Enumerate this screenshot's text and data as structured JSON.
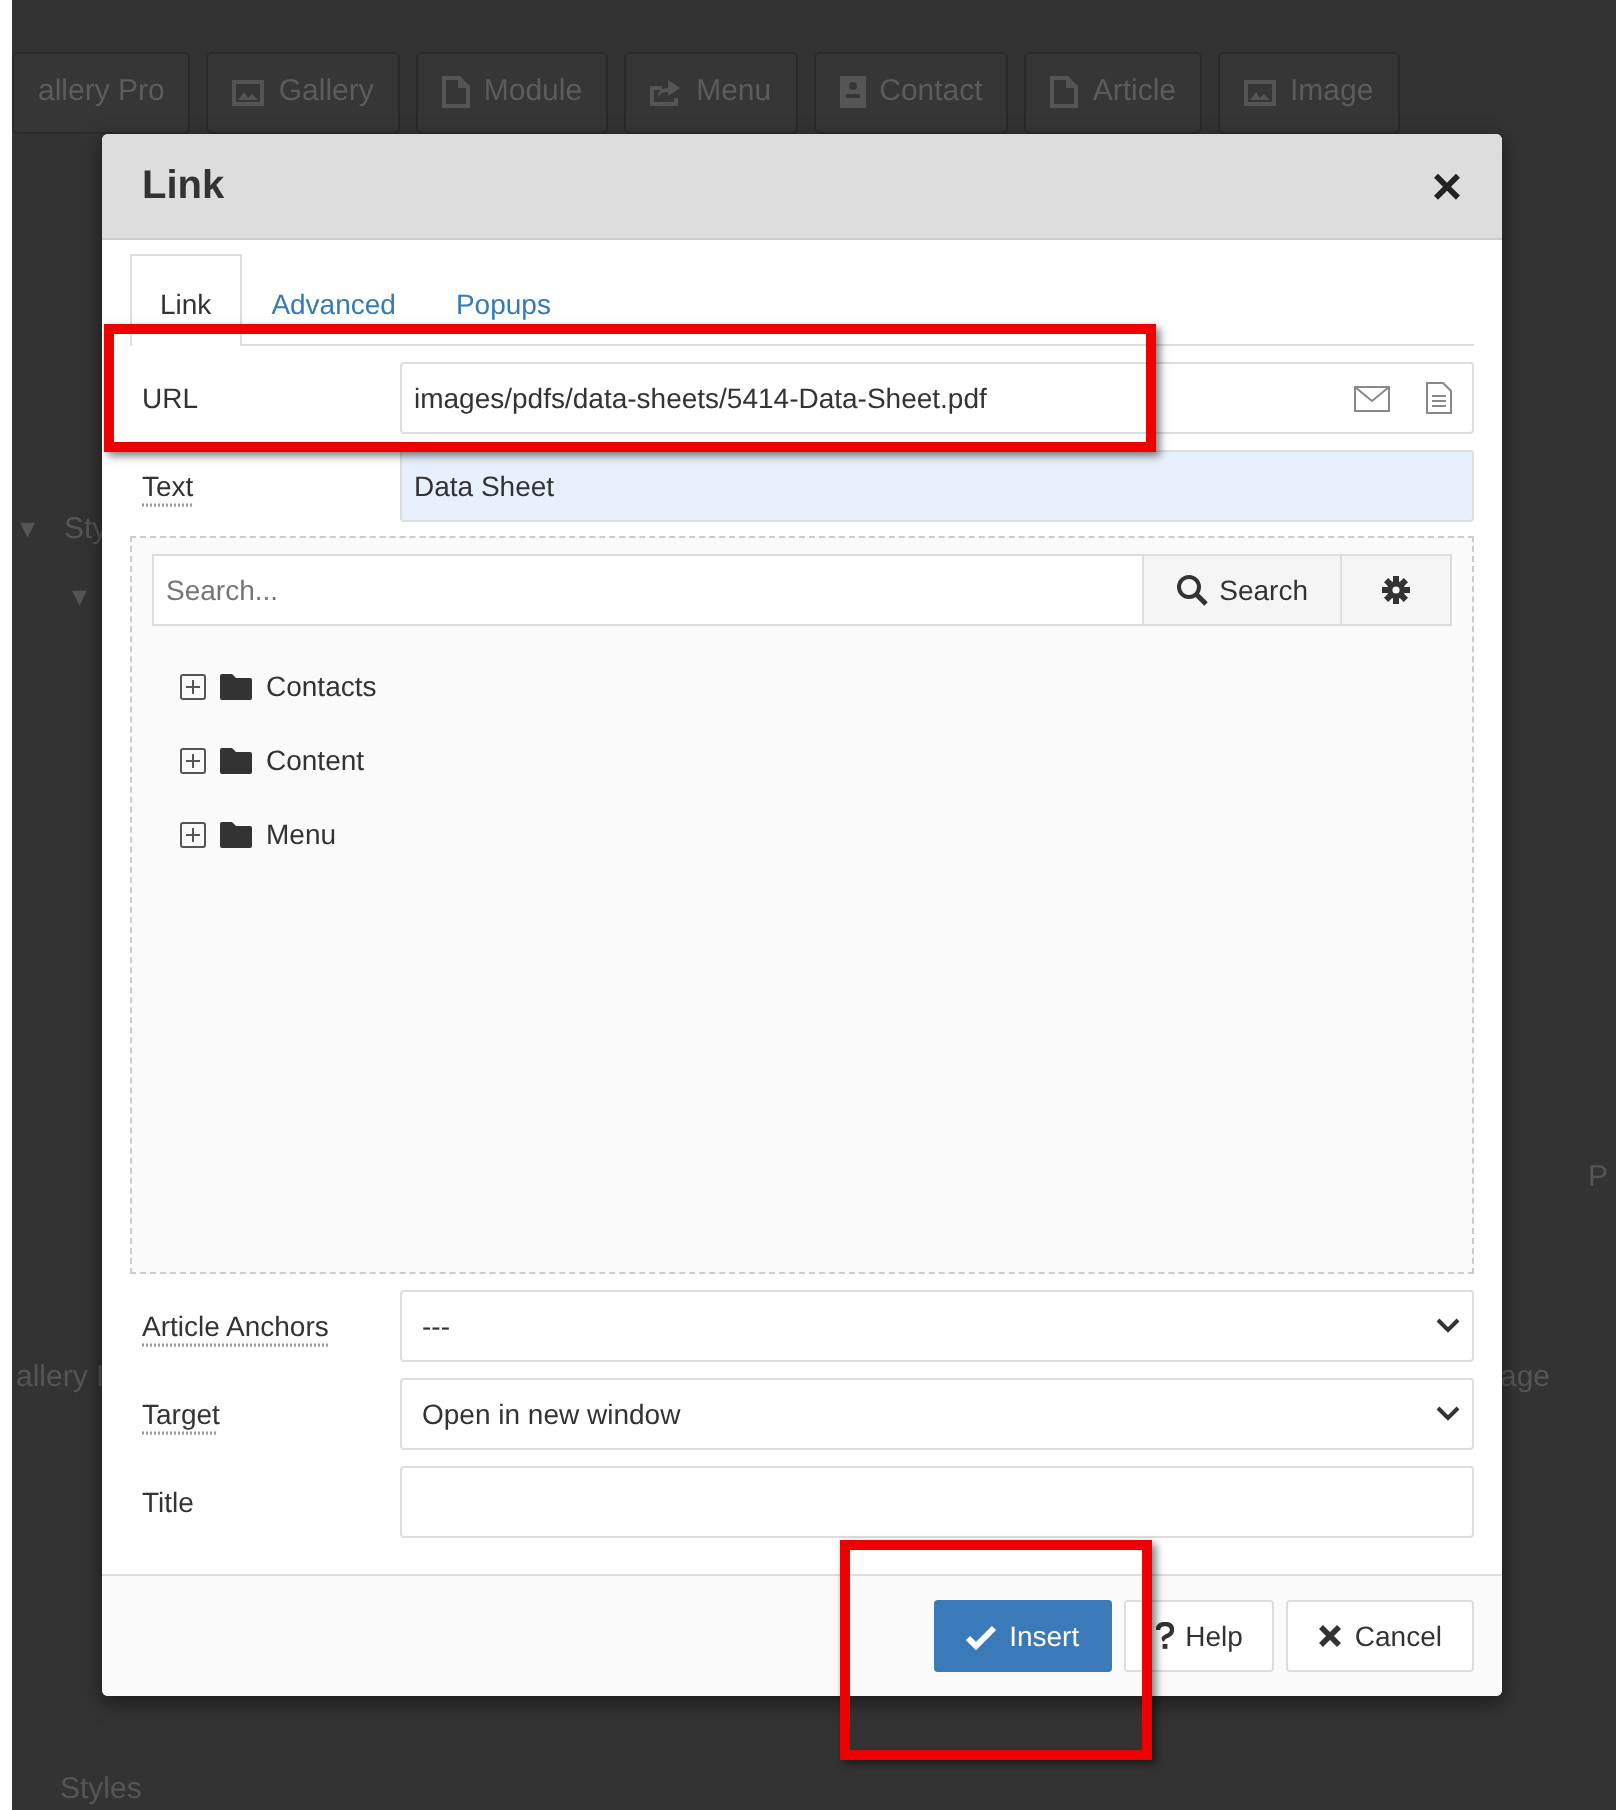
{
  "background_toolbar": [
    {
      "label": "allery Pro",
      "kind": "plain"
    },
    {
      "label": "Gallery",
      "kind": "image"
    },
    {
      "label": "Module",
      "kind": "page"
    },
    {
      "label": "Menu",
      "kind": "share"
    },
    {
      "label": "Contact",
      "kind": "card"
    },
    {
      "label": "Article",
      "kind": "page"
    },
    {
      "label": "Image",
      "kind": "image"
    }
  ],
  "background_texts": [
    {
      "kind": "side",
      "text": "▾"
    },
    {
      "kind": "side",
      "text": "Sty"
    },
    {
      "kind": "side",
      "text": "▾"
    },
    {
      "kind": "right",
      "text": "P"
    },
    {
      "kind": "btn-left",
      "text": "allery I"
    },
    {
      "kind": "btn-right",
      "text": "age"
    },
    {
      "kind": "bottom",
      "text": "Styles"
    }
  ],
  "dialog": {
    "title": "Link",
    "close": "×",
    "tabs": [
      {
        "label": "Link",
        "selected": true
      },
      {
        "label": "Advanced",
        "selected": false
      },
      {
        "label": "Popups",
        "selected": false
      }
    ],
    "url": {
      "label": "URL",
      "value": "images/pdfs/data-sheets/5414-Data-Sheet.pdf",
      "highlighted": true
    },
    "text": {
      "label": "Text",
      "value": "Data Sheet"
    },
    "browser": {
      "search_placeholder": "Search...",
      "search_button": "Search",
      "tree": [
        {
          "label": "Contacts",
          "expanded": false
        },
        {
          "label": "Content",
          "expanded": false
        },
        {
          "label": "Menu",
          "expanded": false
        }
      ]
    },
    "anchors": {
      "label": "Article Anchors",
      "value": "---"
    },
    "target": {
      "label": "Target",
      "value": "Open in new window"
    },
    "title_field": {
      "label": "Title"
    },
    "buttons": [
      {
        "kind": "primary",
        "label": "Insert",
        "highlighted": true
      },
      {
        "kind": "help",
        "label": "Help",
        "highlighted": false
      },
      {
        "kind": "cancel",
        "label": "Cancel",
        "highlighted": false
      }
    ]
  }
}
